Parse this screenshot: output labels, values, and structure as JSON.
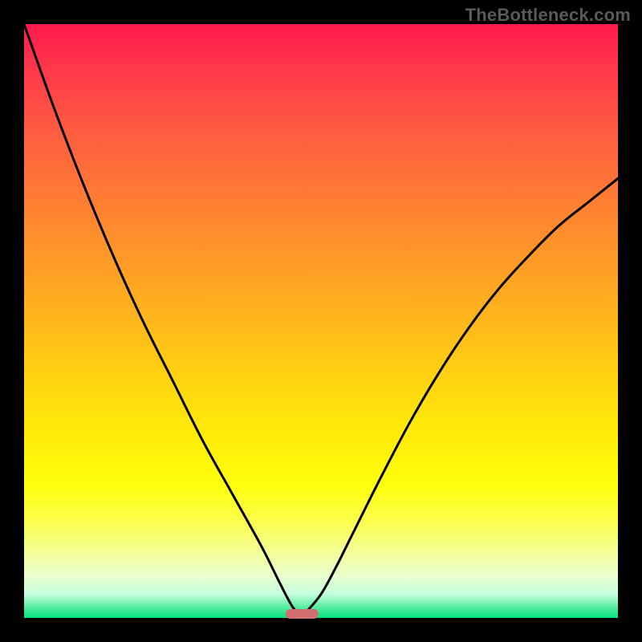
{
  "watermark": "TheBottleneck.com",
  "chart_data": {
    "type": "line",
    "title": "",
    "xlabel": "",
    "ylabel": "",
    "xlim": [
      0,
      1
    ],
    "ylim": [
      0,
      1
    ],
    "series": [
      {
        "name": "curve",
        "x": [
          0.0,
          0.05,
          0.1,
          0.15,
          0.2,
          0.25,
          0.3,
          0.35,
          0.4,
          0.43,
          0.45,
          0.46,
          0.468,
          0.475,
          0.5,
          0.525,
          0.55,
          0.6,
          0.65,
          0.7,
          0.75,
          0.8,
          0.85,
          0.9,
          0.95,
          1.0
        ],
        "y": [
          1.0,
          0.86,
          0.73,
          0.61,
          0.5,
          0.4,
          0.3,
          0.21,
          0.12,
          0.06,
          0.022,
          0.01,
          0.005,
          0.01,
          0.04,
          0.085,
          0.135,
          0.235,
          0.33,
          0.415,
          0.49,
          0.555,
          0.61,
          0.66,
          0.7,
          0.74
        ]
      }
    ],
    "marker": {
      "x_center": 0.468,
      "width": 0.055,
      "color": "#d26f6f"
    },
    "background_gradient": {
      "top": "#ff1a4d",
      "mid": "#ffee08",
      "bottom": "#00e37a"
    }
  }
}
